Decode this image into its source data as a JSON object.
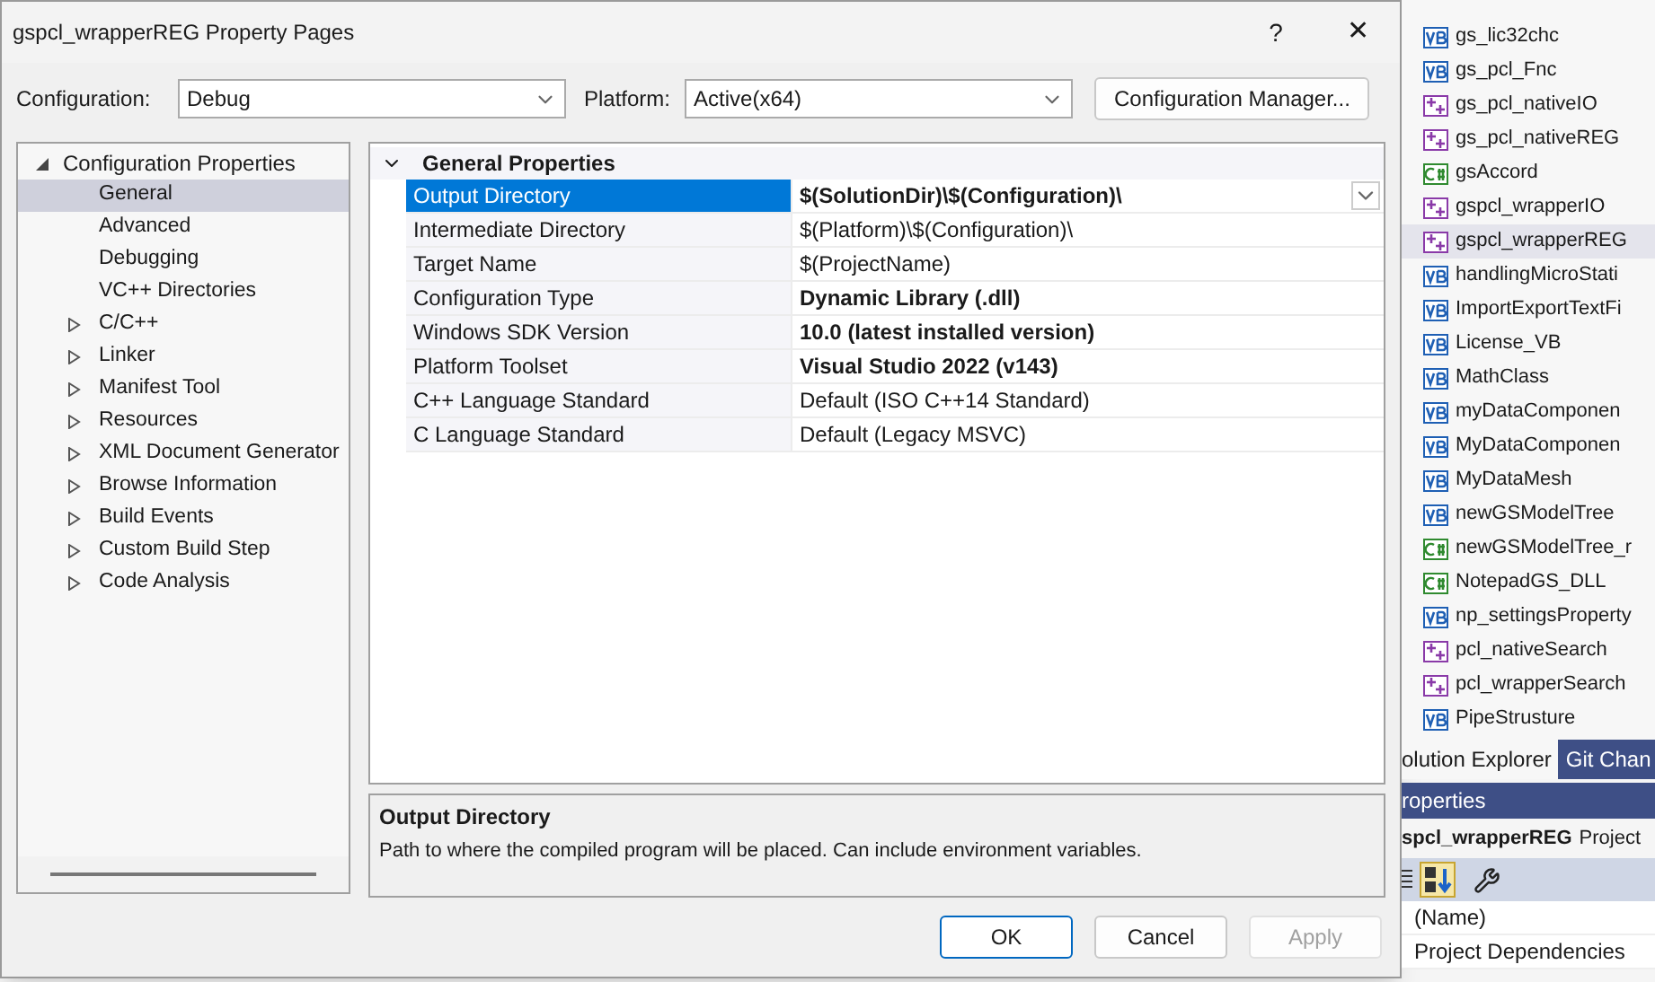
{
  "dialog": {
    "title": "gspcl_wrapperREG Property Pages",
    "help": "?",
    "close": "✕",
    "configuration": {
      "label": "Configuration:",
      "value": "Debug"
    },
    "platform": {
      "label": "Platform:",
      "value": "Active(x64)"
    },
    "manager_button": "Configuration Manager...",
    "tree": [
      {
        "label": "Configuration Properties",
        "expanded": true,
        "selected": false,
        "children": [
          {
            "label": "General",
            "selected": true,
            "has_children": false
          },
          {
            "label": "Advanced",
            "selected": false,
            "has_children": false
          },
          {
            "label": "Debugging",
            "selected": false,
            "has_children": false
          },
          {
            "label": "VC++ Directories",
            "selected": false,
            "has_children": false
          },
          {
            "label": "C/C++",
            "selected": false,
            "has_children": true
          },
          {
            "label": "Linker",
            "selected": false,
            "has_children": true
          },
          {
            "label": "Manifest Tool",
            "selected": false,
            "has_children": true
          },
          {
            "label": "Resources",
            "selected": false,
            "has_children": true
          },
          {
            "label": "XML Document Generator",
            "selected": false,
            "has_children": true
          },
          {
            "label": "Browse Information",
            "selected": false,
            "has_children": true
          },
          {
            "label": "Build Events",
            "selected": false,
            "has_children": true
          },
          {
            "label": "Custom Build Step",
            "selected": false,
            "has_children": true
          },
          {
            "label": "Code Analysis",
            "selected": false,
            "has_children": true
          }
        ]
      }
    ],
    "grid": {
      "section": "General Properties",
      "expanded": true,
      "rows": [
        {
          "name": "Output Directory",
          "value": "$(SolutionDir)\\$(Configuration)\\",
          "bold": true,
          "selected": true
        },
        {
          "name": "Intermediate Directory",
          "value": "$(Platform)\\$(Configuration)\\",
          "bold": false,
          "selected": false
        },
        {
          "name": "Target Name",
          "value": "$(ProjectName)",
          "bold": false,
          "selected": false
        },
        {
          "name": "Configuration Type",
          "value": "Dynamic Library (.dll)",
          "bold": true,
          "selected": false
        },
        {
          "name": "Windows SDK Version",
          "value": "10.0 (latest installed version)",
          "bold": true,
          "selected": false
        },
        {
          "name": "Platform Toolset",
          "value": "Visual Studio 2022 (v143)",
          "bold": true,
          "selected": false
        },
        {
          "name": "C++ Language Standard",
          "value": "Default (ISO C++14 Standard)",
          "bold": false,
          "selected": false
        },
        {
          "name": "C Language Standard",
          "value": "Default (Legacy MSVC)",
          "bold": false,
          "selected": false
        }
      ]
    },
    "description": {
      "title": "Output Directory",
      "text": "Path to where the compiled program will be placed. Can include environment variables."
    },
    "buttons": [
      {
        "label": "OK",
        "disabled": false,
        "default": true
      },
      {
        "label": "Cancel",
        "disabled": false,
        "default": false
      },
      {
        "label": "Apply",
        "disabled": true,
        "default": false
      }
    ]
  },
  "solution_explorer": {
    "items": [
      {
        "label": "gs_lic32chc",
        "kind": "vb",
        "selected": false
      },
      {
        "label": "gs_pcl_Fnc",
        "kind": "vb",
        "selected": false
      },
      {
        "label": "gs_pcl_nativeIO",
        "kind": "cpp",
        "selected": false
      },
      {
        "label": "gs_pcl_nativeREG",
        "kind": "cpp",
        "selected": false
      },
      {
        "label": "gsAccord",
        "kind": "cs",
        "selected": false
      },
      {
        "label": "gspcl_wrapperIO",
        "kind": "cpp",
        "selected": false
      },
      {
        "label": "gspcl_wrapperREG",
        "kind": "cpp",
        "selected": true
      },
      {
        "label": "handlingMicroStati",
        "kind": "vb",
        "selected": false
      },
      {
        "label": "ImportExportTextFi",
        "kind": "vb",
        "selected": false
      },
      {
        "label": "License_VB",
        "kind": "vb",
        "selected": false
      },
      {
        "label": "MathClass",
        "kind": "vb",
        "selected": false
      },
      {
        "label": "myDataComponen",
        "kind": "vb",
        "selected": false
      },
      {
        "label": "MyDataComponen",
        "kind": "vb",
        "selected": false
      },
      {
        "label": "MyDataMesh",
        "kind": "vb",
        "selected": false
      },
      {
        "label": "newGSModelTree",
        "kind": "vb",
        "selected": false
      },
      {
        "label": "newGSModelTree_r",
        "kind": "cs",
        "selected": false
      },
      {
        "label": "NotepadGS_DLL",
        "kind": "cs",
        "selected": false
      },
      {
        "label": "np_settingsProperty",
        "kind": "vb",
        "selected": false
      },
      {
        "label": "pcl_nativeSearch",
        "kind": "cpp",
        "selected": false
      },
      {
        "label": "pcl_wrapperSearch",
        "kind": "cpp",
        "selected": false
      },
      {
        "label": "PipeStrusture",
        "kind": "vb",
        "selected": false
      }
    ],
    "tabs": [
      {
        "label": "olution Explorer",
        "selected": true
      },
      {
        "label": "Git Chan",
        "selected": false
      }
    ],
    "properties": {
      "title": "roperties",
      "object": "spcl_wrapperREG",
      "object_type": "Project",
      "rows": [
        "(Name)",
        "Project Dependencies"
      ]
    }
  }
}
